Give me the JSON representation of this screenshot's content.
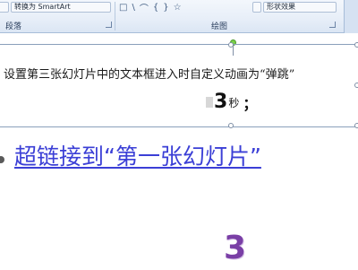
{
  "ribbon": {
    "smartart_button": "转换为 SmartArt",
    "shape_effects_button": "形状效果",
    "groups": {
      "paragraph": "段落",
      "drawing": "绘图",
      "editing_partial": "编"
    },
    "shape_glyphs": [
      "□",
      "\\",
      "⌒",
      "{",
      "}",
      "☆"
    ]
  },
  "slide": {
    "instruction_text": "设置第三张幻灯片中的文本框进入时自定义动画为“弹跳”",
    "seconds_value": "3",
    "seconds_unit": "秒",
    "semicolon": "；",
    "hyperlink_text": "超链接到“第一张幻灯片”",
    "large_number": "3"
  },
  "colors": {
    "hyperlink": "#3b3fd6",
    "large_number": "#7a3fa6",
    "ribbon_bg": "#e7eef8"
  }
}
